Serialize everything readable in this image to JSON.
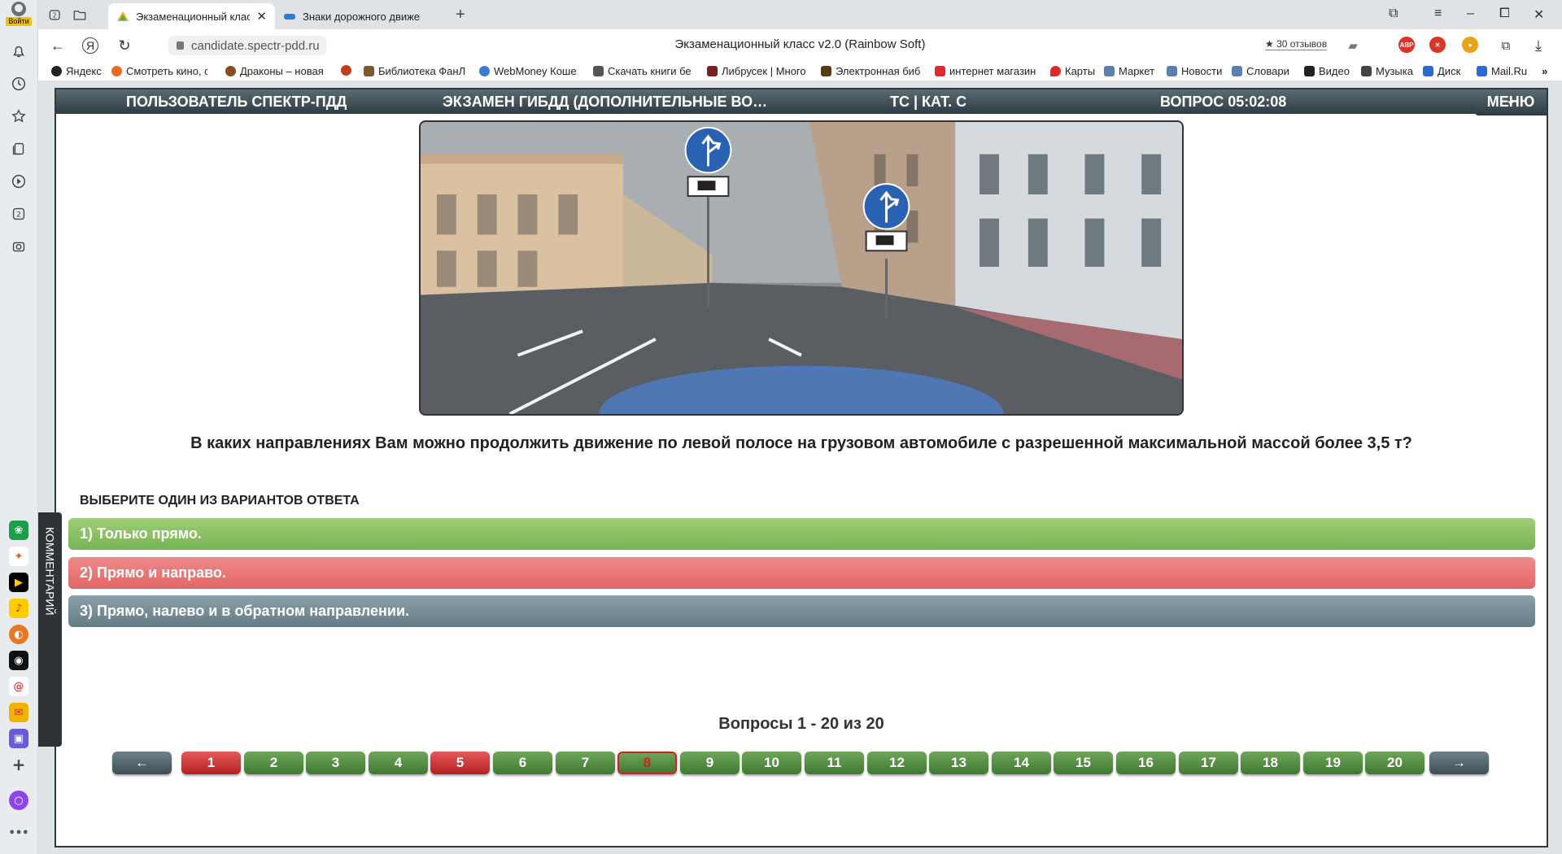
{
  "browser": {
    "login_label": "Войти",
    "tabs": [
      {
        "title": "Экзаменационный класс",
        "active": true
      },
      {
        "title": "Знаки дорожного движения",
        "active": false
      }
    ],
    "tab_count": "2",
    "url": "candidate.spectr-pdd.ru",
    "page_title": "Экзаменационный класс v2.0 (Rainbow Soft)",
    "reviews": "30 отзывов",
    "ext_abp": "ABP",
    "bookmarks": [
      "Яндекс",
      "Смотреть кино, се",
      "Драконы – новая",
      "",
      "Библиотека ФанЛ",
      "WebMoney Коше",
      "Скачать книги бе",
      "Либрусек | Много",
      "Электронная биб",
      "интернет магазин",
      "Карты",
      "Маркет",
      "Новости",
      "Словари",
      "Видео",
      "Музыка",
      "Диск",
      "Mail.Ru"
    ],
    "sidebar_badge": "2"
  },
  "header": {
    "user": "ПОЛЬЗОВАТЕЛЬ СПЕКТР-ПДД",
    "exam": "ЭКЗАМЕН ГИБДД (ДОПОЛНИТЕЛЬНЫЕ ВО…",
    "category": "ТС | КАТ. С",
    "timer": "ВОПРОС 05:02:08",
    "menu": "МЕНЮ"
  },
  "question": {
    "text": "В каких направлениях Вам можно продолжить движение по левой полосе на грузовом автомобиле с разрешенной максимальной массой более 3,5 т?",
    "choose_label": "ВЫБЕРИТЕ ОДИН ИЗ ВАРИАНТОВ ОТВЕТА",
    "answers": [
      {
        "label": "1) Только прямо.",
        "state": "correct"
      },
      {
        "label": "2) Прямо и направо.",
        "state": "wrong"
      },
      {
        "label": "3) Прямо, налево и в обратном направлении.",
        "state": "neutral"
      }
    ]
  },
  "pagination": {
    "summary": "Вопросы 1 - 20 из 20",
    "prev": "←",
    "next": "→",
    "items": [
      {
        "n": "1",
        "state": "wrong"
      },
      {
        "n": "2",
        "state": "correct"
      },
      {
        "n": "3",
        "state": "correct"
      },
      {
        "n": "4",
        "state": "correct"
      },
      {
        "n": "5",
        "state": "wrong"
      },
      {
        "n": "6",
        "state": "correct"
      },
      {
        "n": "7",
        "state": "correct"
      },
      {
        "n": "8",
        "state": "current"
      },
      {
        "n": "9",
        "state": "correct"
      },
      {
        "n": "10",
        "state": "correct"
      },
      {
        "n": "11",
        "state": "correct"
      },
      {
        "n": "12",
        "state": "correct"
      },
      {
        "n": "13",
        "state": "correct"
      },
      {
        "n": "14",
        "state": "correct"
      },
      {
        "n": "15",
        "state": "correct"
      },
      {
        "n": "16",
        "state": "correct"
      },
      {
        "n": "17",
        "state": "correct"
      },
      {
        "n": "18",
        "state": "correct"
      },
      {
        "n": "19",
        "state": "correct"
      },
      {
        "n": "20",
        "state": "correct"
      }
    ]
  },
  "comment_tab": "КОММЕНТАРИЙ"
}
